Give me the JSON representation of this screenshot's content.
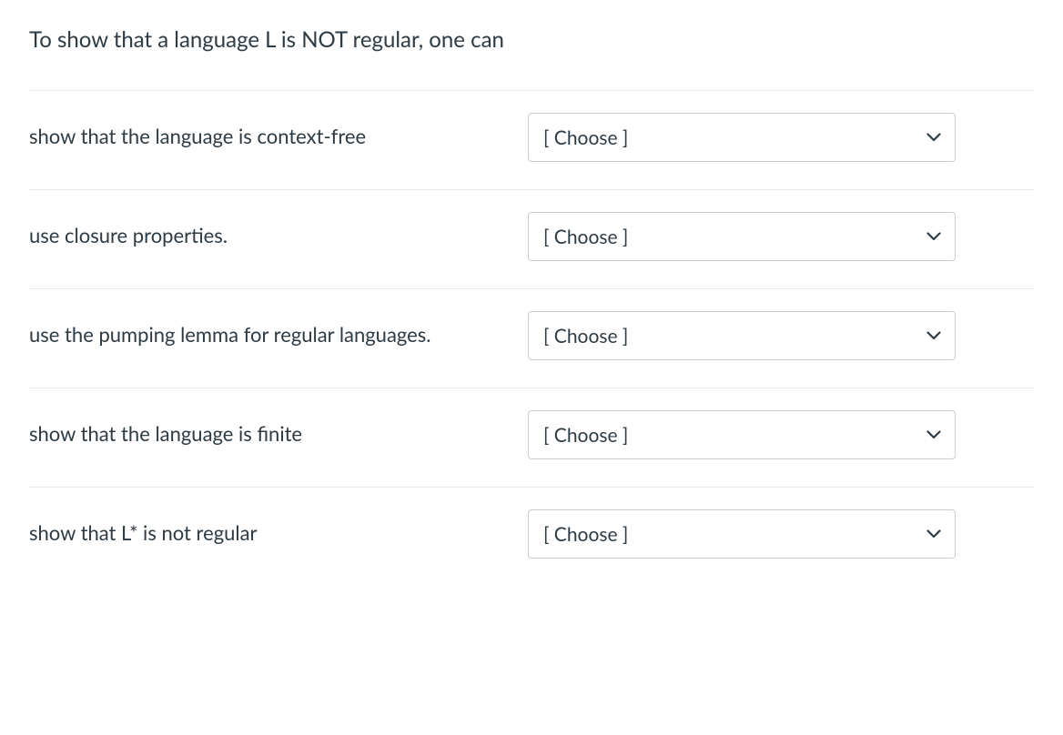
{
  "question": {
    "stem": "To show that a language L is NOT regular, one can"
  },
  "select_placeholder": "[ Choose ]",
  "rows": [
    {
      "label": "show that the language is context-free"
    },
    {
      "label": "use closure properties."
    },
    {
      "label": "use the pumping lemma for regular languages."
    },
    {
      "label": "show that the language is finite"
    },
    {
      "label": "show that L* is not regular"
    }
  ]
}
